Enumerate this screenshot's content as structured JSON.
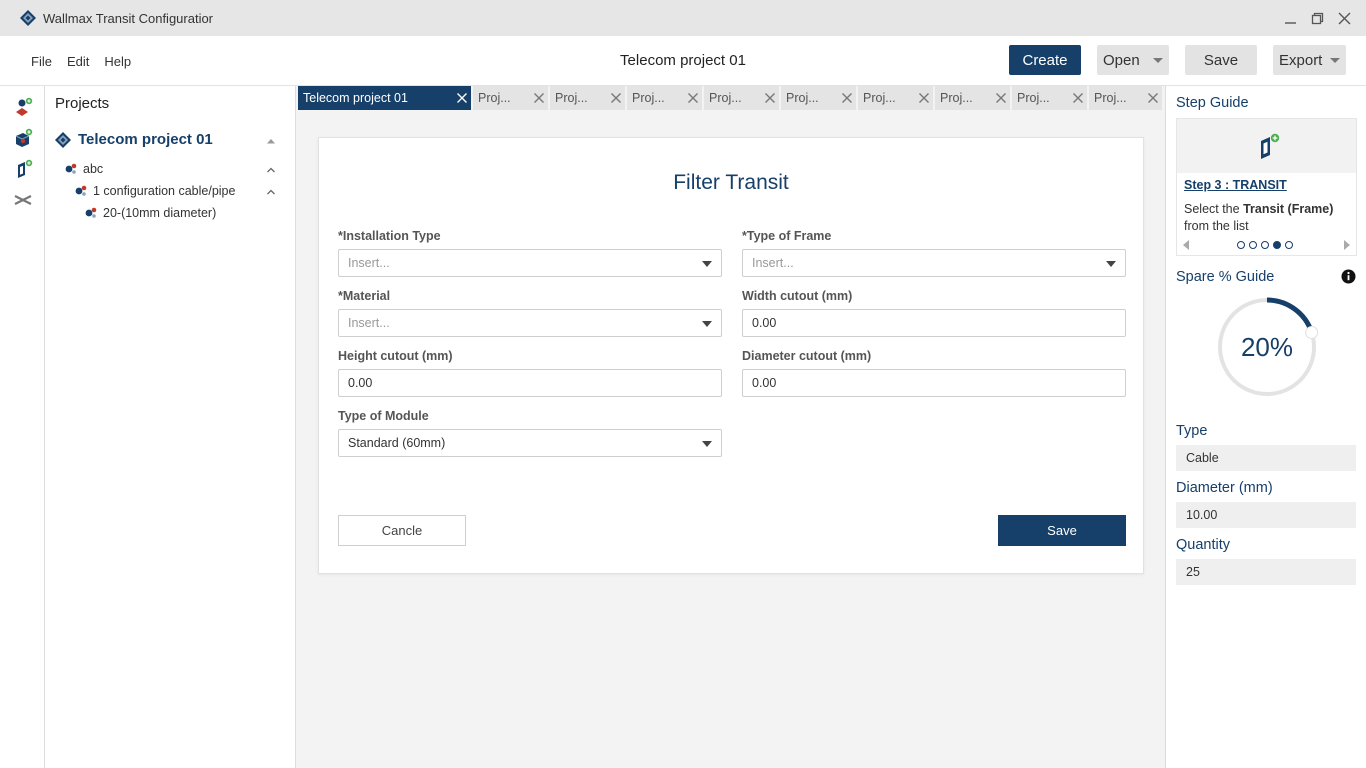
{
  "app": {
    "title": "Wallmax Transit Configuratior",
    "document_title": "Telecom project 01"
  },
  "menu": {
    "file": "File",
    "edit": "Edit",
    "help": "Help"
  },
  "toolbar": {
    "create": "Create",
    "open": "Open",
    "save": "Save",
    "export": "Export"
  },
  "projects": {
    "title": "Projects",
    "root": "Telecom project 01",
    "level1": "abc",
    "level2": "1 configuration cable/pipe",
    "level3": "20-(10mm diameter)"
  },
  "tabs": [
    {
      "label": "Telecom project 01",
      "active": true
    },
    {
      "label": "Proj...",
      "active": false
    },
    {
      "label": "Proj...",
      "active": false
    },
    {
      "label": "Proj...",
      "active": false
    },
    {
      "label": "Proj...",
      "active": false
    },
    {
      "label": "Proj...",
      "active": false
    },
    {
      "label": "Proj...",
      "active": false
    },
    {
      "label": "Proj...",
      "active": false
    },
    {
      "label": "Proj...",
      "active": false
    },
    {
      "label": "Proj...",
      "active": false
    }
  ],
  "filter": {
    "title": "Filter Transit",
    "installation_type": {
      "label": "*Installation Type",
      "placeholder": "Insert..."
    },
    "type_of_frame": {
      "label": "*Type of Frame",
      "placeholder": "Insert..."
    },
    "material": {
      "label": "*Material",
      "placeholder": "Insert..."
    },
    "width_cutout": {
      "label": "Width cutout (mm)",
      "value": "0.00"
    },
    "height_cutout": {
      "label": "Height cutout (mm)",
      "value": "0.00"
    },
    "diameter_cutout": {
      "label": "Diameter cutout (mm)",
      "value": "0.00"
    },
    "type_of_module": {
      "label": "Type of Module",
      "value": "Standard (60mm)"
    },
    "cancel": "Cancle",
    "save": "Save"
  },
  "step_guide": {
    "title": "Step Guide",
    "step": "Step 3 : TRANSIT",
    "text_prefix": "Select the",
    "text_bold": "Transit (Frame)",
    "text_suffix": "from the list",
    "total_steps": 5,
    "current_step": 4
  },
  "spare_guide": {
    "title": "Spare % Guide",
    "value": "20%",
    "fraction": 0.2
  },
  "details": {
    "type_label": "Type",
    "type_value": "Cable",
    "diameter_label": "Diameter (mm)",
    "diameter_value": "10.00",
    "quantity_label": "Quantity",
    "quantity_value": "25"
  },
  "colors": {
    "primary": "#163f6a",
    "accent_green": "#4caf50",
    "panel_grey": "#efefef"
  }
}
